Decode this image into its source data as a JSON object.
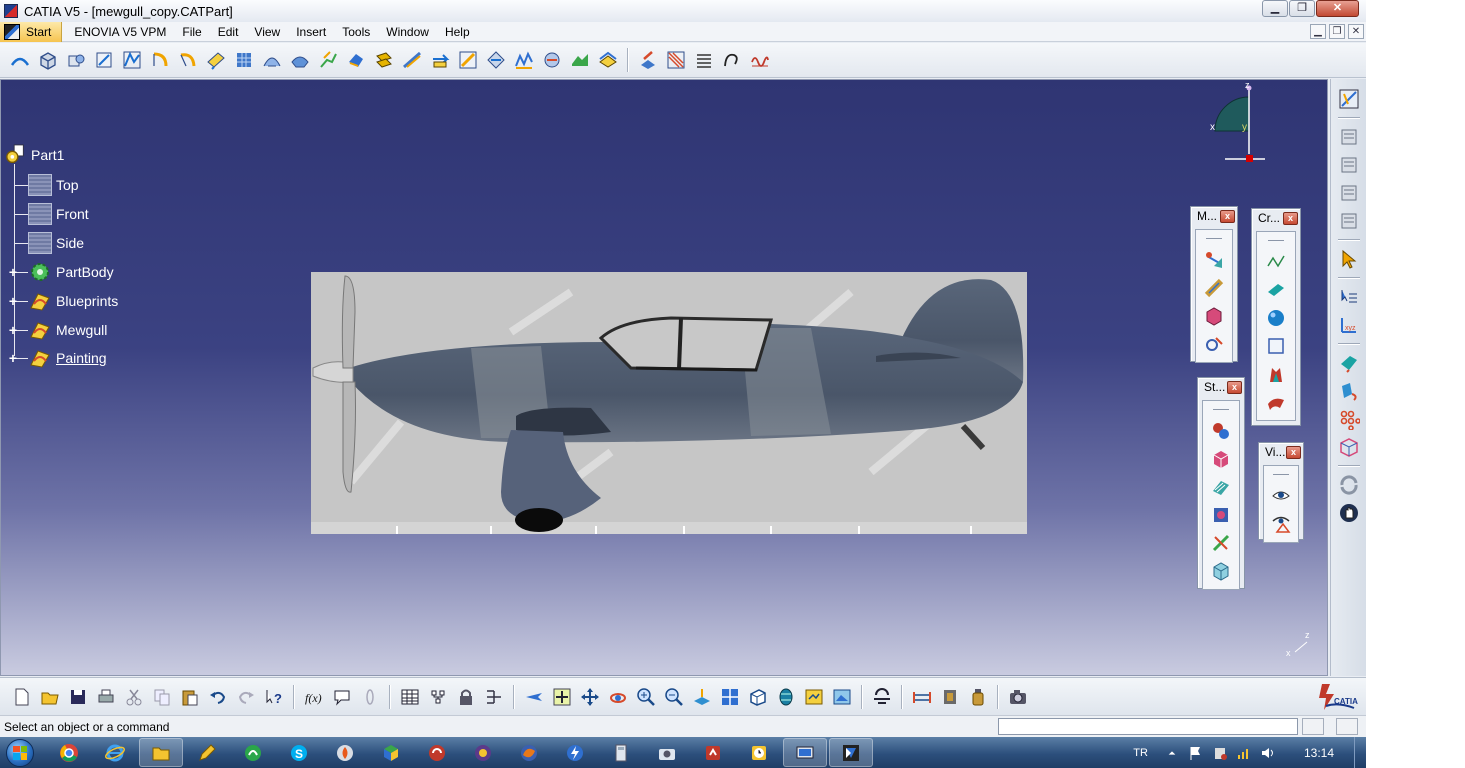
{
  "window": {
    "title": "CATIA V5 - [mewgull_copy.CATPart]",
    "min_label": "▁",
    "max_label": "❐",
    "close_label": "✕"
  },
  "menu": {
    "start": "Start",
    "items": [
      "ENOVIA V5 VPM",
      "File",
      "Edit",
      "View",
      "Insert",
      "Tools",
      "Window",
      "Help"
    ]
  },
  "tree": {
    "root": "Part1",
    "planes": [
      "Top",
      "Front",
      "Side"
    ],
    "nodes": [
      "PartBody",
      "Blueprints",
      "Mewgull",
      "Painting"
    ]
  },
  "compass": {
    "x": "x",
    "y": "y",
    "z": "z"
  },
  "axis_mini": {
    "x": "x",
    "z": "z"
  },
  "palettes": {
    "measure": "M...",
    "create": "Cr...",
    "standard": "St...",
    "view": "Vi...",
    "close": "x"
  },
  "status": {
    "message": "Select an object or a command",
    "command_value": ""
  },
  "taskbar": {
    "language": "TR",
    "clock": "13:14"
  },
  "colors": {
    "viewport_top": "#2f3573",
    "viewport_bottom": "#c9cbe0",
    "tree_text": "#ffffff",
    "start_menu": "#f6c450",
    "taskbar": "#2c4f7c"
  },
  "icons": {
    "top_toolbar": [
      "sketch",
      "pad",
      "pocket",
      "shaft",
      "groove",
      "hole",
      "rib",
      "slot",
      "stiffener",
      "loft",
      "remove-loft",
      "edge-fillet",
      "chamfer",
      "draft",
      "shell",
      "thickness",
      "thread",
      "split",
      "thick-surface",
      "close-surface",
      "sew-surface",
      "boolean",
      "translation",
      "rectangular-pattern"
    ],
    "bottom_toolbar": [
      "new",
      "open",
      "save",
      "print",
      "cut",
      "copy",
      "paste",
      "undo",
      "redo",
      "whats-this",
      "formula",
      "knowledge",
      "parameters",
      "table",
      "tree",
      "lock",
      "join",
      "fly",
      "fit-all",
      "pan",
      "rotate",
      "zoom-in",
      "zoom-out",
      "normal-view",
      "multi-view",
      "quick-view",
      "shading",
      "hide-show",
      "swap",
      "update",
      "measure",
      "apply-material",
      "camera"
    ],
    "right_toolbar": [
      "compass-view",
      "layer-1",
      "layer-2",
      "layer-3",
      "layer-4",
      "select",
      "selection-set",
      "axis-system",
      "sketcher",
      "surface",
      "pattern",
      "box",
      "refresh",
      "manipulate"
    ]
  }
}
